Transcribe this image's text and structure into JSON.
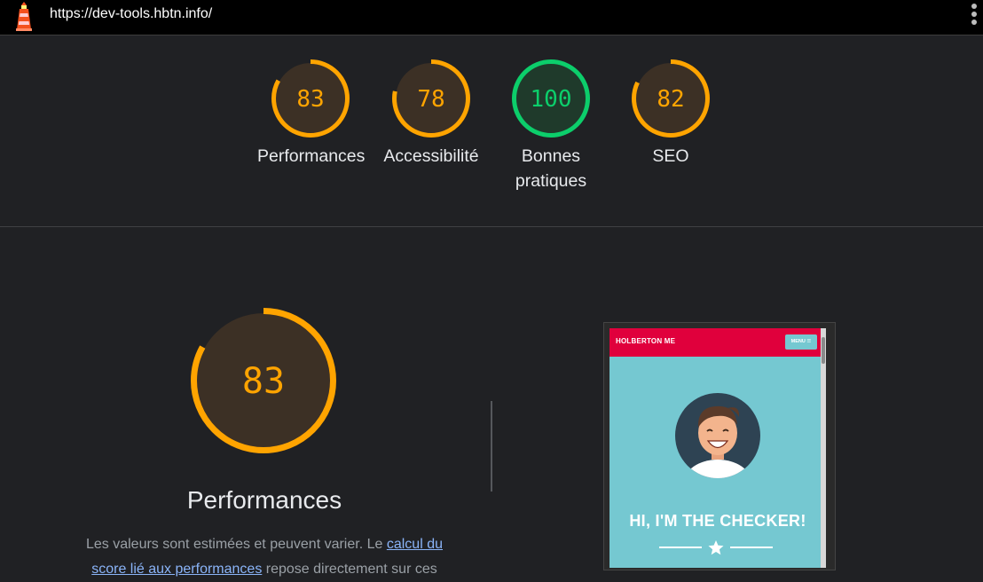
{
  "topbar": {
    "url": "https://dev-tools.hbtn.info/",
    "logo_icon": "lighthouse-icon",
    "menu_icon": "kebab-menu-icon"
  },
  "colors": {
    "average": "#ffa400",
    "pass": "#0cce6b",
    "background": "#202124"
  },
  "summary_gauges": [
    {
      "label": "Performances",
      "score": "83",
      "status": "average"
    },
    {
      "label": "Accessibilité",
      "score": "78",
      "status": "average"
    },
    {
      "label_line1": "Bonnes",
      "label_line2": "pratiques",
      "score": "100",
      "status": "pass"
    },
    {
      "label": "SEO",
      "score": "82",
      "status": "average"
    }
  ],
  "category": {
    "score": "83",
    "title": "Performances",
    "description_start": "Les valeurs sont estimées et peuvent varier. Le ",
    "description_link": "calcul du score lié aux performances",
    "description_end": " repose directement sur ces"
  },
  "screenshot": {
    "brand": "HOLBERTON ME",
    "menu_label": "MENU ☰",
    "hero_text": "HI, I'M THE CHECKER!"
  }
}
